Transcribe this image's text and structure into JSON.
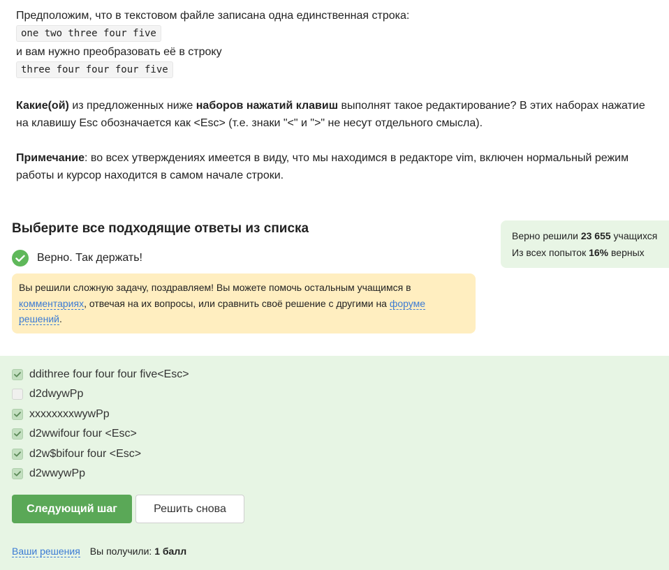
{
  "task": {
    "intro": "Предположим, что в текстовом файле записана одна единственная строка:",
    "source_line": "one two three four five",
    "transform_text": "и вам нужно преобразовать её в строку",
    "target_line": "three four four four five",
    "q_bold1": "Какие(ой)",
    "q_text1": " из предложенных ниже ",
    "q_bold2": "наборов нажатий клавиш",
    "q_text2": " выполнят такое редактирование? В этих наборах нажатие на клавишу Esc обозначается как <Esc> (т.е. знаки \"<\" и \">\" не несут отдельного смысла).",
    "note_bold": "Примечание",
    "note_text": ": во всех утверждениях имеется в виду, что мы находимся в редакторе vim, включен нормальный режим работы и курсор находится в самом начале строки."
  },
  "heading": "Выберите все подходящие ответы из списка",
  "stats": {
    "solved_prefix": "Верно решили ",
    "solved_count": "23 655",
    "solved_suffix": " учащихся",
    "attempts_prefix": "Из всех попыток ",
    "attempts_percent": "16%",
    "attempts_suffix": " верных"
  },
  "result": {
    "text": "Верно. Так держать!"
  },
  "hint": {
    "part1": "Вы решили сложную задачу, поздравляем! Вы можете помочь остальным учащимся в ",
    "link_comments": "комментариях",
    "part2": ", отвечая на их вопросы, или сравнить своё решение с другими на ",
    "link_forum": "форуме решений",
    "part3": "."
  },
  "options": [
    {
      "label": "ddithree four four four five<Esc>",
      "checked": true
    },
    {
      "label": "d2dwywPp",
      "checked": false
    },
    {
      "label": "xxxxxxxxwywPp",
      "checked": true
    },
    {
      "label": "d2wwifour four <Esc>",
      "checked": true
    },
    {
      "label": "d2w$bifour four <Esc>",
      "checked": true
    },
    {
      "label": "d2wwywPp",
      "checked": true
    }
  ],
  "buttons": {
    "next": "Следующий шаг",
    "retry": "Решить снова"
  },
  "footer": {
    "solutions_link": "Ваши решения",
    "score_prefix": "Вы получили: ",
    "score_value": "1 балл"
  },
  "colors": {
    "accent_green": "#5aa857",
    "success_bg": "#e7f5e4",
    "hint_bg": "#ffeec0",
    "link": "#3b7bd4"
  }
}
